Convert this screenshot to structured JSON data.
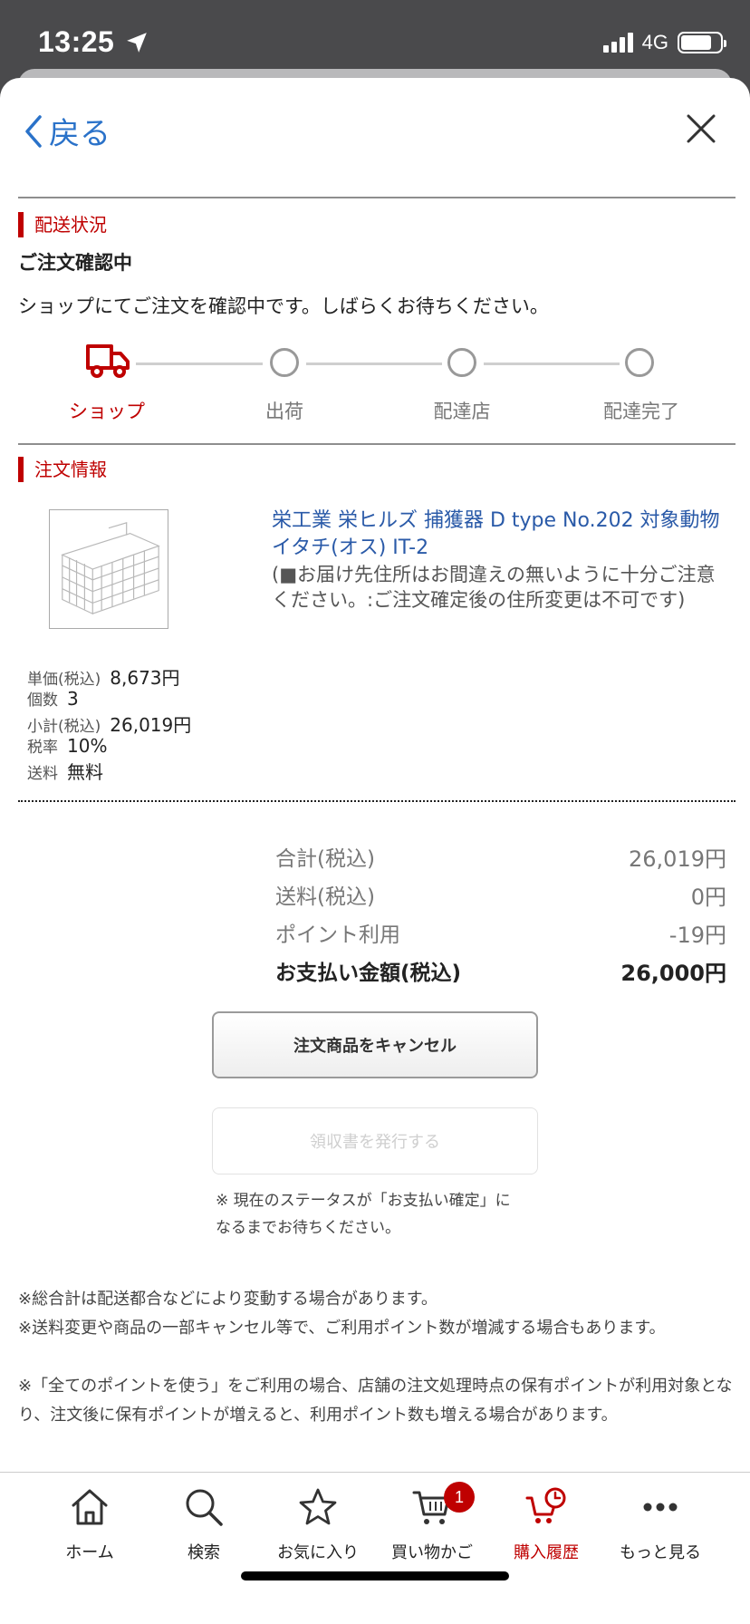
{
  "status_bar": {
    "time": "13:25",
    "network": "4G"
  },
  "nav": {
    "back_label": "戻る"
  },
  "shipping": {
    "section_title": "配送状況",
    "status_title": "ご注文確認中",
    "status_desc": "ショップにてご注文を確認中です。しばらくお待ちください。",
    "steps": [
      "ショップ",
      "出荷",
      "配達店",
      "配達完了"
    ]
  },
  "order": {
    "section_title": "注文情報",
    "product_title": "栄工業 栄ヒルズ 捕獲器 D type No.202 対象動物イタチ(オス) IT-2",
    "product_note": "(■お届け先住所はお間違えの無いように十分ご注意ください。:ご注文確定後の住所変更は不可です)",
    "details": [
      {
        "key": "単価(税込)",
        "value": "8,673円"
      },
      {
        "key": "個数",
        "value": "3"
      },
      {
        "key": "小計(税込)",
        "value": "26,019円"
      },
      {
        "key": "税率",
        "value": "10%"
      },
      {
        "key": "送料",
        "value": "無料"
      }
    ]
  },
  "summary": [
    {
      "label": "合計(税込)",
      "value": "26,019円"
    },
    {
      "label": "送料(税込)",
      "value": "0円"
    },
    {
      "label": "ポイント利用",
      "value": "-19円"
    },
    {
      "label": "お支払い金額(税込)",
      "value": "26,000円"
    }
  ],
  "buttons": {
    "cancel": "注文商品をキャンセル",
    "receipt": "領収書を発行する",
    "note_line1": "※ 現在のステータスが「お支払い確定」に",
    "note_line2": "なるまでお待ちください。"
  },
  "footnotes": [
    "※総合計は配送都合などにより変動する場合があります。",
    "※送料変更や商品の一部キャンセル等で、ご利用ポイント数が増減する場合もあります。",
    "※「全てのポイントを使う」をご利用の場合、店舗の注文処理時点の保有ポイントが利用対象となり、注文後に保有ポイントが増えると、利用ポイント数も増える場合があります。"
  ],
  "tabs": [
    {
      "label": "ホーム",
      "icon": "home-icon"
    },
    {
      "label": "検索",
      "icon": "search-icon"
    },
    {
      "label": "お気に入り",
      "icon": "star-icon"
    },
    {
      "label": "買い物かご",
      "icon": "cart-icon",
      "badge": "1"
    },
    {
      "label": "購入履歴",
      "icon": "purchase-history-icon",
      "active": true
    },
    {
      "label": "もっと見る",
      "icon": "more-icon"
    }
  ],
  "colors": {
    "accent": "#bf0000",
    "link": "#2a5aa8",
    "back": "#2a72c9"
  }
}
